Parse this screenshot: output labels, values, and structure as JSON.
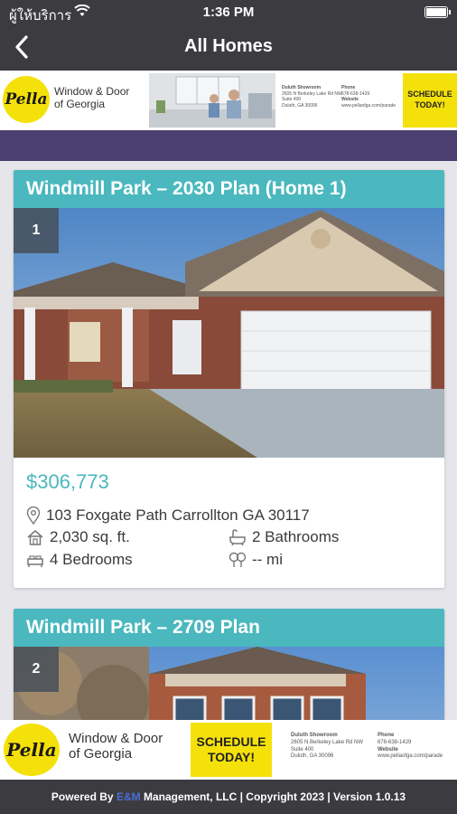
{
  "status": {
    "carrier": "ผู้ให้บริการ",
    "time": "1:36 PM",
    "wifi_icon": "wifi-icon",
    "battery_icon": "battery-icon"
  },
  "nav": {
    "title": "All Homes",
    "back_icon": "chevron-left-icon"
  },
  "ad_top": {
    "brand": "Pella",
    "line1": "Window & Door",
    "line2": "of Georgia",
    "showroom_title": "Duluth Showroom",
    "address1": "2605 N Berkeley Lake Rd NW",
    "address2": "Suite 400",
    "address3": "Duluth, GA 30096",
    "phone_label": "Phone",
    "phone": "678-638-1429",
    "website_label": "Website",
    "website": "www.pellaofga.com/parade",
    "cta_line1": "SCHEDULE",
    "cta_line2": "TODAY!"
  },
  "listings": [
    {
      "title": "Windmill Park – 2030 Plan (Home 1)",
      "number": "1",
      "price": "$306,773",
      "address": "103 Foxgate Path Carrollton GA 30117",
      "sqft": "2,030 sq. ft.",
      "bathrooms": "2 Bathrooms",
      "bedrooms": "4 Bedrooms",
      "distance": "-- mi"
    },
    {
      "title": "Windmill Park – 2709 Plan",
      "number": "2"
    }
  ],
  "ad_bottom": {
    "brand": "Pella",
    "line1": "Window & Door",
    "line2": "of Georgia",
    "cta_line1": "SCHEDULE",
    "cta_line2": "TODAY!",
    "showroom_title": "Duluth Showroom",
    "address1": "2605 N Berkeley Lake Rd NW",
    "address2": "Suite 400",
    "address3": "Duluth, GA 30096",
    "phone_label": "Phone",
    "phone": "678-638-1429",
    "website_label": "Website",
    "website": "www.pellaofga.com/parade"
  },
  "footer": {
    "prefix": "Powered By ",
    "em": "E&M",
    "suffix": " Management, LLC | Copyright 2023 | Version 1.0.13"
  },
  "colors": {
    "nav_bg": "#3c3c40",
    "accent": "#4ab8be",
    "purple_band": "#4b3f6f",
    "pella_yellow": "#f5e10a"
  }
}
